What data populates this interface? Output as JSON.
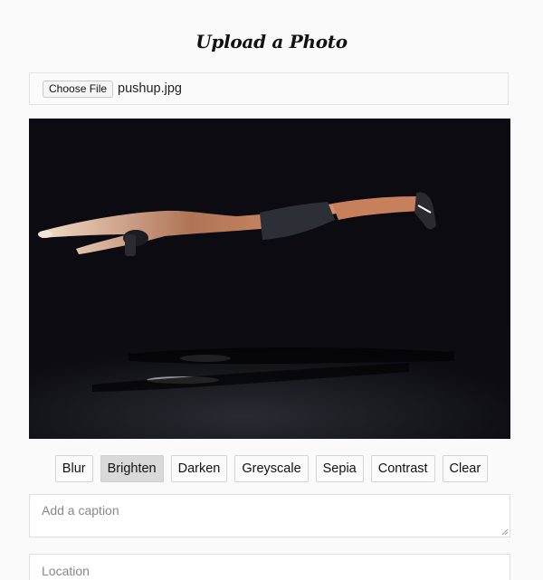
{
  "header": {
    "title": "Upload a Photo"
  },
  "file_input": {
    "button_label": "Choose File",
    "file_name": "pushup.jpg"
  },
  "photo": {
    "description_icon": "uploaded-photo"
  },
  "filters": {
    "items": [
      {
        "label": "Blur",
        "active": false
      },
      {
        "label": "Brighten",
        "active": true
      },
      {
        "label": "Darken",
        "active": false
      },
      {
        "label": "Greyscale",
        "active": false
      },
      {
        "label": "Sepia",
        "active": false
      },
      {
        "label": "Contrast",
        "active": false
      },
      {
        "label": "Clear",
        "active": false
      }
    ]
  },
  "caption": {
    "placeholder": "Add a caption"
  },
  "location": {
    "placeholder": "Location"
  },
  "colors": {
    "page_bg": "#fafafa",
    "active_filter_bg": "#d9d9d9",
    "photo_bg": "#0c0c12"
  }
}
